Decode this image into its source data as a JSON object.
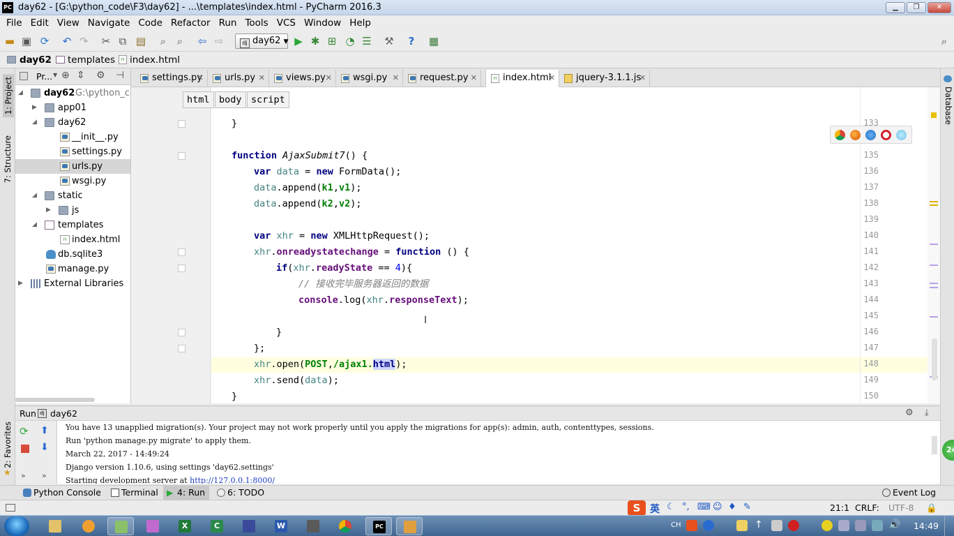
{
  "window": {
    "title": "day62 - [G:\\python_code\\F3\\day62] - ...\\templates\\index.html - PyCharm 2016.3",
    "app_logo": "PC"
  },
  "menu": [
    "File",
    "Edit",
    "View",
    "Navigate",
    "Code",
    "Refactor",
    "Run",
    "Tools",
    "VCS",
    "Window",
    "Help"
  ],
  "toolbar": {
    "run_config": "day62",
    "icons": [
      "open-folder-icon",
      "save-icon",
      "sync-icon",
      "undo-icon",
      "redo-icon",
      "cut-icon",
      "copy-icon",
      "paste-icon",
      "find-icon",
      "replace-icon",
      "back-icon",
      "forward-icon",
      "run-icon",
      "debug-icon",
      "coverage-icon",
      "profile-icon",
      "concurrency-icon",
      "settings-icon",
      "help-icon",
      "terminal-icon",
      "search-icon"
    ]
  },
  "breadcrumb": [
    "day62",
    "templates",
    "index.html"
  ],
  "left_stripe": {
    "project": "1: Project",
    "structure": "7: Structure",
    "favorites": "2: Favorites"
  },
  "right_stripe": {
    "database": "Database"
  },
  "project_panel": {
    "header": "Pr...",
    "tree": [
      {
        "label": "day62",
        "path": "G:\\python_cod",
        "type": "folder",
        "depth": 0,
        "open": true
      },
      {
        "label": "app01",
        "type": "folder",
        "depth": 1,
        "open": false
      },
      {
        "label": "day62",
        "type": "folder",
        "depth": 1,
        "open": true
      },
      {
        "label": "__init__.py",
        "type": "py",
        "depth": 2
      },
      {
        "label": "settings.py",
        "type": "py",
        "depth": 2
      },
      {
        "label": "urls.py",
        "type": "py",
        "depth": 2,
        "selected": true
      },
      {
        "label": "wsgi.py",
        "type": "py",
        "depth": 2
      },
      {
        "label": "static",
        "type": "folder",
        "depth": 1,
        "open": true
      },
      {
        "label": "js",
        "type": "folder",
        "depth": 2,
        "open": false
      },
      {
        "label": "templates",
        "type": "folder",
        "depth": 1,
        "open": true
      },
      {
        "label": "index.html",
        "type": "html",
        "depth": 2
      },
      {
        "label": "db.sqlite3",
        "type": "db",
        "depth": 1
      },
      {
        "label": "manage.py",
        "type": "py",
        "depth": 1
      },
      {
        "label": "External Libraries",
        "type": "lib",
        "depth": 0,
        "open": false
      }
    ]
  },
  "editor_tabs": [
    {
      "label": "settings.py",
      "active": false
    },
    {
      "label": "urls.py",
      "active": false
    },
    {
      "label": "views.py",
      "active": false
    },
    {
      "label": "wsgi.py",
      "active": false
    },
    {
      "label": "request.py",
      "active": false
    },
    {
      "label": "index.html",
      "active": true
    },
    {
      "label": "jquery-3.1.1.js",
      "active": false
    }
  ],
  "tag_breadcrumb": [
    "html",
    "body",
    "script"
  ],
  "code": {
    "lines": [
      {
        "n": "133",
        "text": "}"
      },
      {
        "n": "134",
        "text": ""
      },
      {
        "n": "135",
        "text": "function AjaxSubmit7() {"
      },
      {
        "n": "136",
        "text": "var data = new FormData();"
      },
      {
        "n": "137",
        "text": "data.append('k1','v1');"
      },
      {
        "n": "138",
        "text": "data.append('k2','v2');"
      },
      {
        "n": "139",
        "text": ""
      },
      {
        "n": "140",
        "text": "var xhr = new XMLHttpRequest();"
      },
      {
        "n": "141",
        "text": "xhr.onreadystatechange = function () {"
      },
      {
        "n": "142",
        "text": "if(xhr.readyState == 4){"
      },
      {
        "n": "143",
        "text": "// 接收完毕服务器返回的数据"
      },
      {
        "n": "144",
        "text": "console.log(xhr.responseText);"
      },
      {
        "n": "145",
        "text": ""
      },
      {
        "n": "146",
        "text": "}"
      },
      {
        "n": "147",
        "text": "};"
      },
      {
        "n": "148",
        "text": "xhr.open('POST','/ajax1.html');"
      },
      {
        "n": "149",
        "text": "xhr.send(data);"
      },
      {
        "n": "150",
        "text": "}"
      }
    ]
  },
  "run_panel": {
    "label": "Run",
    "config": "day62",
    "console": [
      "You have 13 unapplied migration(s). Your project may not work properly until you apply the migrations for app(s): admin, auth, contenttypes, sessions.",
      "Run 'python manage.py migrate' to apply them.",
      "March 22, 2017 - 14:49:24",
      "Django version 1.10.6, using settings 'day62.settings'",
      "Starting development server at "
    ],
    "server_url": "http://127.0.0.1:8000/"
  },
  "tool_tabs": [
    {
      "label": "Python Console",
      "active": false
    },
    {
      "label": "Terminal",
      "active": false
    },
    {
      "label": "4: Run",
      "active": true
    },
    {
      "label": "6: TODO",
      "active": false
    }
  ],
  "event_log": "Event Log",
  "status": {
    "position": "21:1",
    "line_sep": "CRLF:",
    "encoding": "UTF-8",
    "ime": "英"
  },
  "taskbar": {
    "clock": "14:49",
    "lang": "CH",
    "apps": [
      "explorer",
      "firefox-like",
      "notepad",
      "paint",
      "excel",
      "code",
      "save",
      "word",
      "tool",
      "chrome",
      "pycharm",
      "media"
    ],
    "badge": "24"
  },
  "colors": {
    "keyword": "#000080",
    "string": "#008000",
    "number": "#0000ff",
    "comment": "#808080",
    "current_line": "#ffffe0"
  }
}
